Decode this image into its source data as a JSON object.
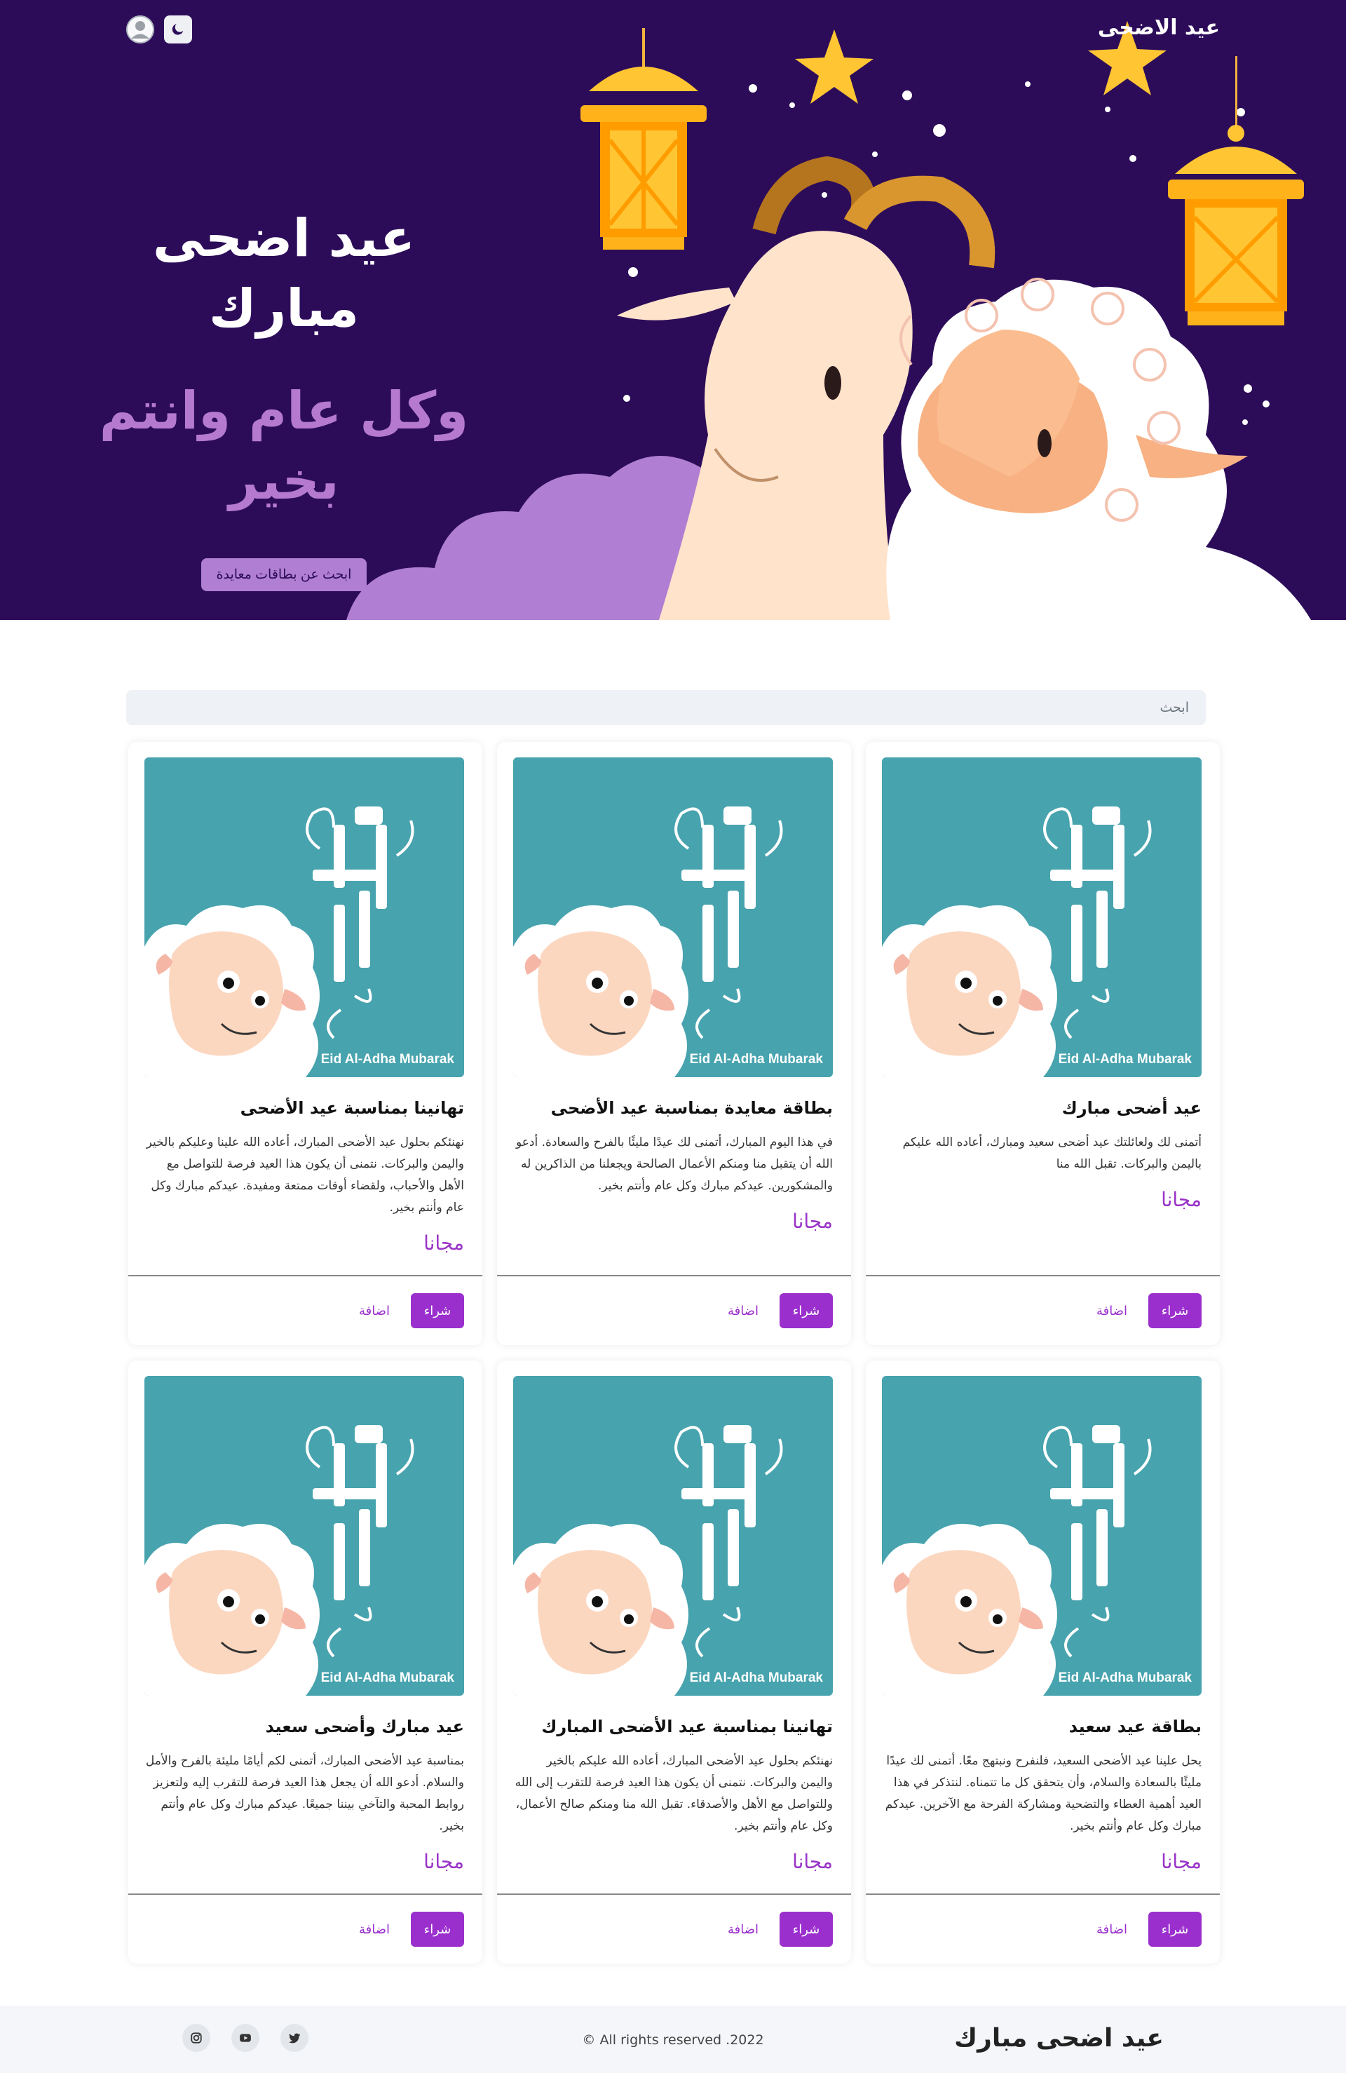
{
  "nav": {
    "brand": "عيد الاضحى",
    "icons": [
      "moon-icon",
      "user-avatar-icon"
    ]
  },
  "hero": {
    "title": "عيد اضحى مبارك",
    "subtitle": "وكل عام وانتم بخير",
    "cta": "ابحث عن بطاقات معايدة"
  },
  "search": {
    "placeholder": "ابحث"
  },
  "cards": [
    {
      "title": "عيد أضحى مبارك",
      "description": "أتمنى لك ولعائلتك عيد أضحى سعيد ومبارك، أعاده الله عليكم باليمن والبركات. تقبل الله منا",
      "price": "مجانا",
      "image_caption": "Eid Al-Adha Mubarak",
      "buy_label": "شراء",
      "add_label": "اضافة"
    },
    {
      "title": "بطاقة معايدة بمناسبة عيد الأضحى",
      "description": "في هذا اليوم المبارك، أتمنى لك عيدًا مليئًا بالفرح والسعادة. أدعو الله أن يتقبل منا ومنكم الأعمال الصالحة ويجعلنا من الذاكرين له والمشكورين. عيدكم مبارك وكل عام وأنتم بخير.",
      "price": "مجانا",
      "image_caption": "Eid Al-Adha Mubarak",
      "buy_label": "شراء",
      "add_label": "اضافة"
    },
    {
      "title": "تهانينا بمناسبة عيد الأضحى",
      "description": "نهنئكم بحلول عيد الأضحى المبارك، أعاده الله علينا وعليكم بالخير واليمن والبركات. نتمنى أن يكون هذا العيد فرصة للتواصل مع الأهل والأحباب، ولقضاء أوقات ممتعة ومفيدة. عيدكم مبارك وكل عام وأنتم بخير.",
      "price": "مجانا",
      "image_caption": "Eid Al-Adha Mubarak",
      "buy_label": "شراء",
      "add_label": "اضافة"
    },
    {
      "title": "بطاقة عيد سعيد",
      "description": "يحل علينا عيد الأضحى السعيد، فلنفرح ونبتهج معًا. أتمنى لك عيدًا مليئًا بالسعادة والسلام، وأن يتحقق كل ما تتمناه. لنتذكر في هذا العيد أهمية العطاء والتضحية ومشاركة الفرحة مع الآخرين. عيدكم مبارك وكل عام وأنتم بخير.",
      "price": "مجانا",
      "image_caption": "Eid Al-Adha Mubarak",
      "buy_label": "شراء",
      "add_label": "اضافة"
    },
    {
      "title": "تهانينا بمناسبة عيد الأضحى المبارك",
      "description": "نهنئكم بحلول عيد الأضحى المبارك، أعاده الله عليكم بالخير واليمن والبركات. نتمنى أن يكون هذا العيد فرصة للتقرب إلى الله وللتواصل مع الأهل والأصدقاء. تقبل الله منا ومنكم صالح الأعمال، وكل عام وأنتم بخير.",
      "price": "مجانا",
      "image_caption": "Eid Al-Adha Mubarak",
      "buy_label": "شراء",
      "add_label": "اضافة"
    },
    {
      "title": "عيد مبارك وأضحى سعيد",
      "description": "بمناسبة عيد الأضحى المبارك، أتمنى لكم أيامًا مليئة بالفرح والأمل والسلام. أدعو الله أن يجعل هذا العيد فرصة للتقرب إليه ولتعزيز روابط المحبة والتآخي بيننا جميعًا. عيدكم مبارك وكل عام وأنتم بخير.",
      "price": "مجانا",
      "image_caption": "Eid Al-Adha Mubarak",
      "buy_label": "شراء",
      "add_label": "اضافة"
    }
  ],
  "footer": {
    "brand": "عيد اضحى مبارك",
    "copyright": "All rights reserved .2022 ©",
    "socials": [
      "twitter-icon",
      "youtube-icon",
      "instagram-icon"
    ]
  },
  "colors": {
    "hero_bg": "#2c0c59",
    "accent": "#9b2fcd",
    "card_image_bg": "#47a3ae",
    "subtitle": "#b57ad0"
  }
}
